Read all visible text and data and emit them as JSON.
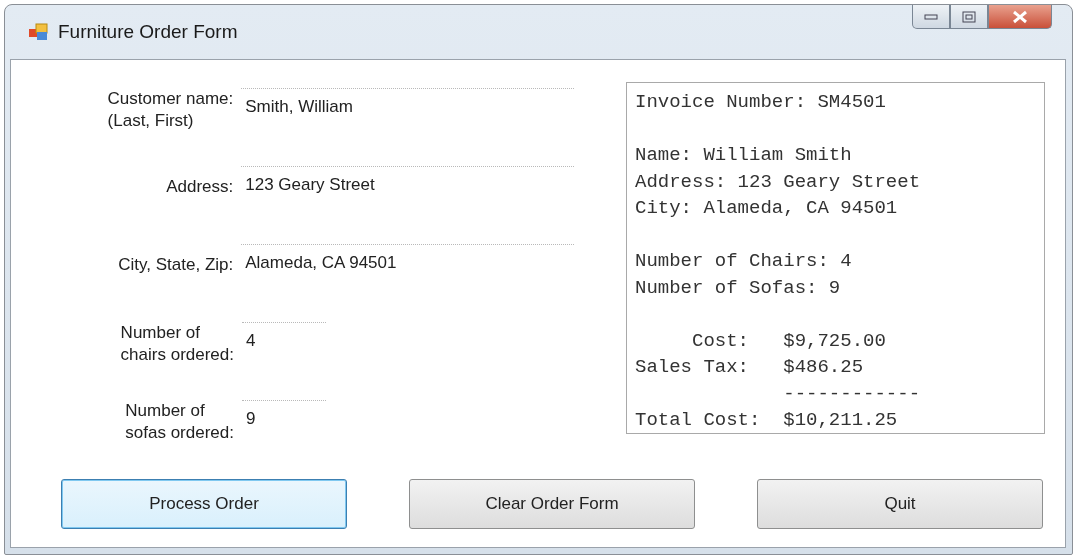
{
  "window": {
    "title": "Furniture Order Form"
  },
  "fields": [
    {
      "label": "Customer name:\n(Last, First)",
      "value": "Smith, William",
      "kind": "text"
    },
    {
      "label": "Address:",
      "value": "123 Geary Street",
      "kind": "text"
    },
    {
      "label": "City, State, Zip:",
      "value": "Alameda, CA 94501",
      "kind": "text"
    },
    {
      "label": "Number of\nchairs ordered:",
      "value": "4",
      "kind": "number"
    },
    {
      "label": "Number of\nsofas ordered:",
      "value": "9",
      "kind": "number"
    }
  ],
  "invoice": {
    "groups": [
      [
        "Invoice Number: SM4501"
      ],
      [
        "Name: William Smith",
        "Address: 123 Geary Street",
        "City: Alameda, CA 94501"
      ],
      [
        "Number of Chairs: 4",
        "Number of Sofas: 9"
      ],
      [
        "     Cost:   $9,725.00",
        "Sales Tax:   $486.25",
        "             ------------",
        "Total Cost:  $10,211.25"
      ]
    ]
  },
  "buttons": [
    {
      "label": "Process Order",
      "focused": true
    },
    {
      "label": "Clear Order Form",
      "focused": false
    },
    {
      "label": "Quit",
      "focused": false
    }
  ]
}
